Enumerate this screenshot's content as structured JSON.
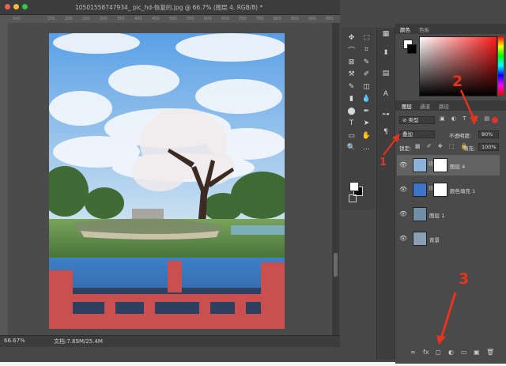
{
  "window": {
    "title": "10501558747934_ pic_hd-恢复的.jpg @ 66.7% (图层 4, RGB/8) *"
  },
  "ruler_ticks": [
    "500",
    "",
    "150",
    "200",
    "250",
    "300",
    "350",
    "400",
    "450",
    "500",
    "550",
    "600",
    "650",
    "700",
    "750",
    "800",
    "850",
    "900",
    "950"
  ],
  "status": {
    "zoom": "66.67%",
    "doc": "文档:7.89M/25.4M"
  },
  "tools": [
    "✥",
    "⬚",
    "⌒",
    "⌗",
    "⊠",
    "✎",
    "⚒",
    "✐",
    "✎",
    "◫",
    "▮",
    "💧",
    "⬤",
    "✒",
    "T",
    "➤",
    "▭",
    "✋",
    "🔍",
    "…"
  ],
  "mini_tools": [
    "▦",
    "⬍",
    "▤",
    "A",
    "⊶",
    "¶"
  ],
  "color_panel": {
    "tab_color": "颜色",
    "tab_swatches": "色板",
    "accent": "#ff1a1a"
  },
  "layers_panel": {
    "tabs": [
      "图层",
      "通道",
      "路径"
    ],
    "filter_kind": "⊘ 类型",
    "blend_mode": "叠加",
    "opacity_label": "不透明度:",
    "opacity_value": "80%",
    "lock_label": "锁定:",
    "fill_label": "填充:",
    "fill_value": "100%",
    "layers": [
      {
        "name": "图层 4",
        "selected": true,
        "link": true
      },
      {
        "name": "颜色填充 1",
        "selected": false,
        "link": true
      },
      {
        "name": "图层 1",
        "selected": false,
        "link": false
      },
      {
        "name": "背景",
        "selected": false,
        "link": false
      }
    ],
    "bottom_icons": [
      "∞",
      "fx",
      "◻",
      "◐",
      "▭",
      "▣",
      "🗑"
    ]
  },
  "annotations": {
    "n1": "1",
    "n2": "2",
    "n3": "3",
    "color": "#e8341c"
  }
}
